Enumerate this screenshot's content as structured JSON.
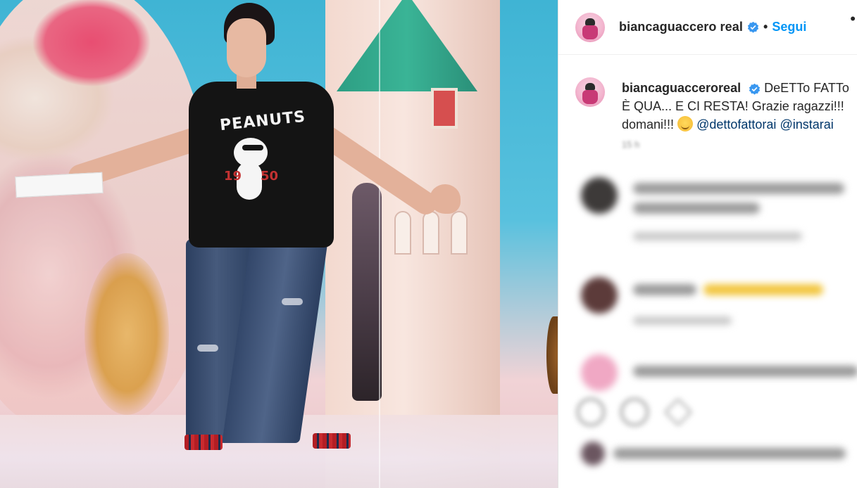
{
  "photo": {
    "shirt_brand": "PEANUTS",
    "year_left": "19",
    "year_right": "50"
  },
  "sidebar": {
    "header": {
      "username": "biancaguaccero real",
      "separator": "•",
      "follow_label": "Segui",
      "more_label": "•"
    },
    "caption": {
      "username": "biancaguacceroreal",
      "line1": "DeETTo FATTo",
      "line2": "È QUA... E CI RESTA! Grazie ragazzi!!!",
      "line3_prefix": "domani!!!",
      "mentions": [
        "@dettofattorai",
        "@instarai"
      ],
      "time": "15 h"
    }
  }
}
